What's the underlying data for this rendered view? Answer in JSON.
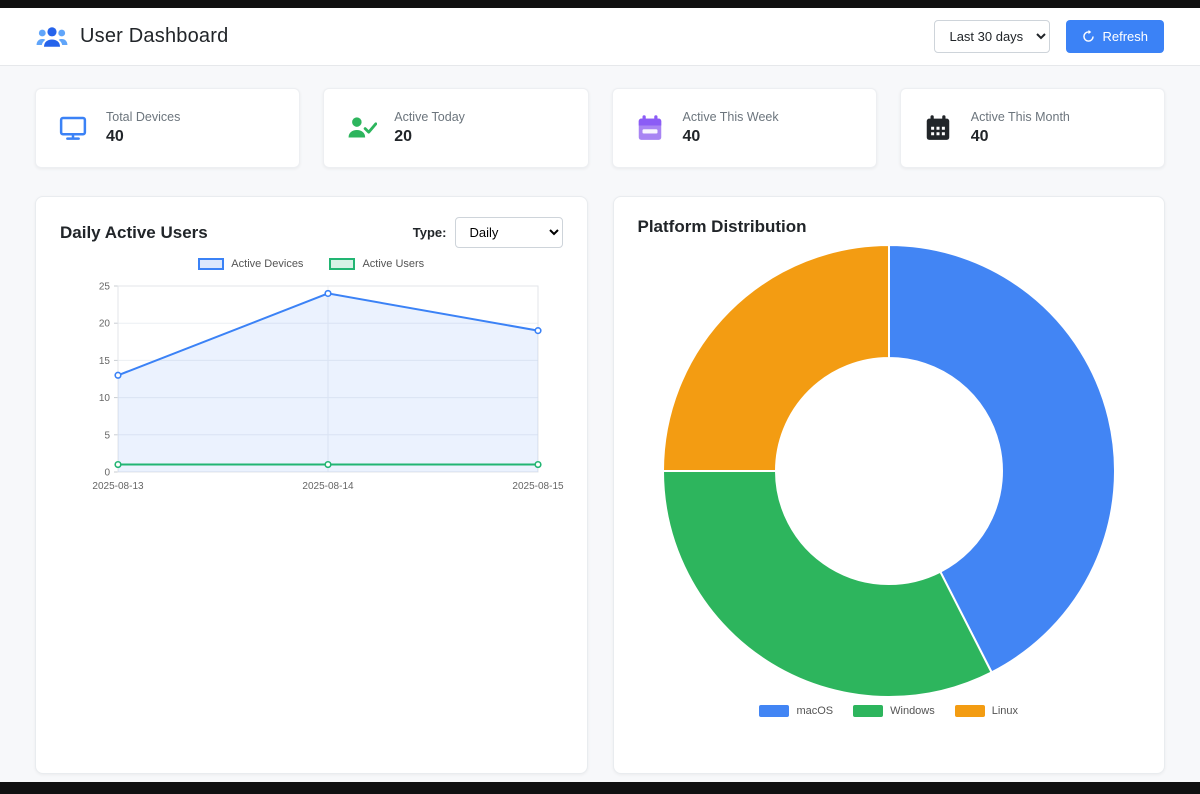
{
  "header": {
    "title": "User Dashboard",
    "range_value": "Last 30 days",
    "refresh_label": "Refresh",
    "accent_color": "#3b82f6"
  },
  "stats": [
    {
      "label": "Total Devices",
      "value": "40",
      "icon": "monitor-icon",
      "color": "#3b82f6"
    },
    {
      "label": "Active Today",
      "value": "20",
      "icon": "user-check-icon",
      "color": "#2db55d"
    },
    {
      "label": "Active This Week",
      "value": "40",
      "icon": "calendar-week-icon",
      "color": "#8b5cf6"
    },
    {
      "label": "Active This Month",
      "value": "40",
      "icon": "calendar-month-icon",
      "color": "#212529"
    }
  ],
  "daily_panel": {
    "title": "Daily Active Users",
    "type_label": "Type:",
    "type_value": "Daily"
  },
  "platform_panel": {
    "title": "Platform Distribution"
  },
  "chart_data": [
    {
      "type": "line",
      "title": "Daily Active Users",
      "x": [
        "2025-08-13",
        "2025-08-14",
        "2025-08-15"
      ],
      "series": [
        {
          "name": "Active Devices",
          "values": [
            13,
            24,
            19
          ],
          "color": "#3b82f6",
          "fill": "rgba(59,130,246,0.10)"
        },
        {
          "name": "Active Users",
          "values": [
            1,
            1,
            1
          ],
          "color": "#22b573",
          "fill": "rgba(34,181,115,0.10)"
        }
      ],
      "ylim": [
        0,
        25
      ],
      "yticks": [
        0,
        5,
        10,
        15,
        20,
        25
      ],
      "grid": true,
      "legend_position": "top"
    },
    {
      "type": "pie",
      "title": "Platform Distribution",
      "donut": true,
      "labels": [
        "macOS",
        "Windows",
        "Linux"
      ],
      "values": [
        17,
        13,
        10
      ],
      "percentages": [
        42.5,
        32.5,
        25
      ],
      "colors": [
        "#4285f4",
        "#2db55d",
        "#f39c12"
      ],
      "legend_position": "bottom"
    }
  ]
}
